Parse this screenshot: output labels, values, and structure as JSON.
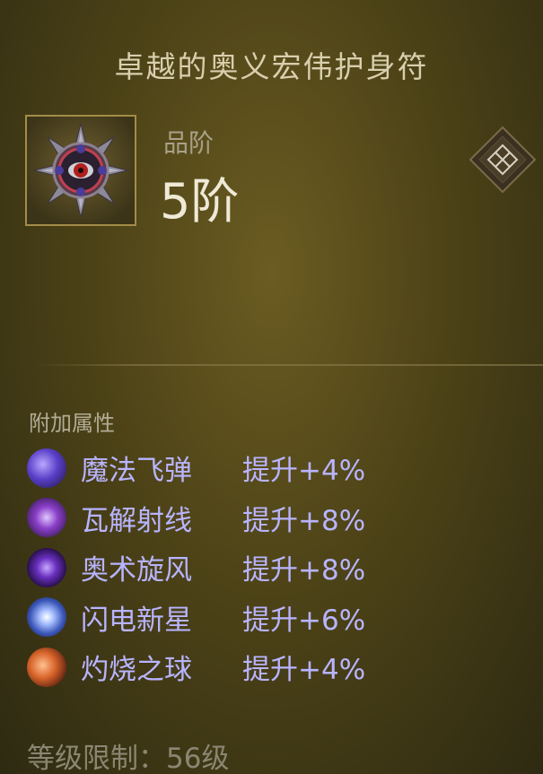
{
  "item": {
    "title": "卓越的奥义宏伟护身符",
    "tier_label": "品阶",
    "tier_value": "5阶"
  },
  "affixes_section": {
    "label": "附加属性",
    "items": [
      {
        "name": "魔法飞弹",
        "bonus": "提升+4%",
        "icon": "magic-missile-icon",
        "color": "#6a4fd8"
      },
      {
        "name": "瓦解射线",
        "bonus": "提升+8%",
        "icon": "disintegrate-icon",
        "color": "#8a3fc8"
      },
      {
        "name": "奥术旋风",
        "bonus": "提升+8%",
        "icon": "arcane-orb-icon",
        "color": "#7a3fd0"
      },
      {
        "name": "闪电新星",
        "bonus": "提升+6%",
        "icon": "lightning-nova-icon",
        "color": "#4a66c8"
      },
      {
        "name": "灼烧之球",
        "bonus": "提升+4%",
        "icon": "fireball-icon",
        "color": "#c8642a"
      }
    ]
  },
  "requirements": {
    "level_text": "等级限制：56级"
  },
  "colors": {
    "affix_text": "#b8b4ff",
    "title_text": "#d8cfae",
    "frame_gold": "#a48c48"
  }
}
